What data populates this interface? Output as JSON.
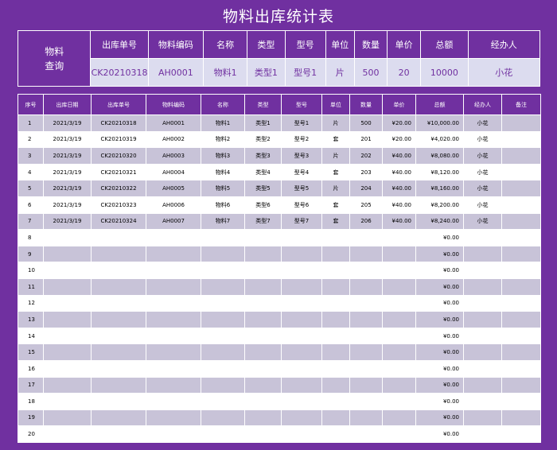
{
  "title": "物料出库统计表",
  "query": {
    "label": "物料\n查询",
    "headers": [
      "出库单号",
      "物料编码",
      "名称",
      "类型",
      "型号",
      "单位",
      "数量",
      "单价",
      "总额",
      "经办人"
    ],
    "values": [
      "CK20210318",
      "AH0001",
      "物料1",
      "类型1",
      "型号1",
      "片",
      "500",
      "20",
      "10000",
      "小花"
    ]
  },
  "table": {
    "headers": [
      "序号",
      "出库日期",
      "出库单号",
      "物料编码",
      "名称",
      "类型",
      "型号",
      "单位",
      "数量",
      "单价",
      "总额",
      "经办人",
      "备注"
    ],
    "rows": [
      [
        "1",
        "2021/3/19",
        "CK20210318",
        "AH0001",
        "物料1",
        "类型1",
        "型号1",
        "片",
        "500",
        "¥20.00",
        "¥10,000.00",
        "小花",
        ""
      ],
      [
        "2",
        "2021/3/19",
        "CK20210319",
        "AH0002",
        "物料2",
        "类型2",
        "型号2",
        "套",
        "201",
        "¥20.00",
        "¥4,020.00",
        "小花",
        ""
      ],
      [
        "3",
        "2021/3/19",
        "CK20210320",
        "AH0003",
        "物料3",
        "类型3",
        "型号3",
        "片",
        "202",
        "¥40.00",
        "¥8,080.00",
        "小花",
        ""
      ],
      [
        "4",
        "2021/3/19",
        "CK20210321",
        "AH0004",
        "物料4",
        "类型4",
        "型号4",
        "套",
        "203",
        "¥40.00",
        "¥8,120.00",
        "小花",
        ""
      ],
      [
        "5",
        "2021/3/19",
        "CK20210322",
        "AH0005",
        "物料5",
        "类型5",
        "型号5",
        "片",
        "204",
        "¥40.00",
        "¥8,160.00",
        "小花",
        ""
      ],
      [
        "6",
        "2021/3/19",
        "CK20210323",
        "AH0006",
        "物料6",
        "类型6",
        "型号6",
        "套",
        "205",
        "¥40.00",
        "¥8,200.00",
        "小花",
        ""
      ],
      [
        "7",
        "2021/3/19",
        "CK20210324",
        "AH0007",
        "物料7",
        "类型7",
        "型号7",
        "套",
        "206",
        "¥40.00",
        "¥8,240.00",
        "小花",
        ""
      ],
      [
        "8",
        "",
        "",
        "",
        "",
        "",
        "",
        "",
        "",
        "",
        "¥0.00",
        "",
        ""
      ],
      [
        "9",
        "",
        "",
        "",
        "",
        "",
        "",
        "",
        "",
        "",
        "¥0.00",
        "",
        ""
      ],
      [
        "10",
        "",
        "",
        "",
        "",
        "",
        "",
        "",
        "",
        "",
        "¥0.00",
        "",
        ""
      ],
      [
        "11",
        "",
        "",
        "",
        "",
        "",
        "",
        "",
        "",
        "",
        "¥0.00",
        "",
        ""
      ],
      [
        "12",
        "",
        "",
        "",
        "",
        "",
        "",
        "",
        "",
        "",
        "¥0.00",
        "",
        ""
      ],
      [
        "13",
        "",
        "",
        "",
        "",
        "",
        "",
        "",
        "",
        "",
        "¥0.00",
        "",
        ""
      ],
      [
        "14",
        "",
        "",
        "",
        "",
        "",
        "",
        "",
        "",
        "",
        "¥0.00",
        "",
        ""
      ],
      [
        "15",
        "",
        "",
        "",
        "",
        "",
        "",
        "",
        "",
        "",
        "¥0.00",
        "",
        ""
      ],
      [
        "16",
        "",
        "",
        "",
        "",
        "",
        "",
        "",
        "",
        "",
        "¥0.00",
        "",
        ""
      ],
      [
        "17",
        "",
        "",
        "",
        "",
        "",
        "",
        "",
        "",
        "",
        "¥0.00",
        "",
        ""
      ],
      [
        "18",
        "",
        "",
        "",
        "",
        "",
        "",
        "",
        "",
        "",
        "¥0.00",
        "",
        ""
      ],
      [
        "19",
        "",
        "",
        "",
        "",
        "",
        "",
        "",
        "",
        "",
        "¥0.00",
        "",
        ""
      ],
      [
        "20",
        "",
        "",
        "",
        "",
        "",
        "",
        "",
        "",
        "",
        "¥0.00",
        "",
        ""
      ]
    ]
  }
}
